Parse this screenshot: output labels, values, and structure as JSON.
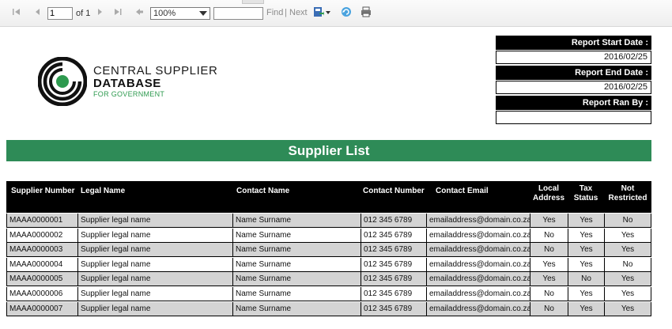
{
  "toolbar": {
    "page_current": "1",
    "page_of": "of 1",
    "zoom": "100%",
    "find_value": "",
    "find_label": "Find",
    "separator": "|",
    "next_label": "Next"
  },
  "logo": {
    "line1": "CENTRAL SUPPLIER",
    "line2": "DATABASE",
    "line3": "FOR GOVERNMENT"
  },
  "report_info": {
    "start_label": "Report Start Date :",
    "start_value": "2016/02/25",
    "end_label": "Report End Date  :",
    "end_value": "2016/02/25",
    "ran_by_label": "Report Ran By   :",
    "ran_by_value": ""
  },
  "title": "Supplier List",
  "table": {
    "headers": {
      "supplier_number": "Supplier Number",
      "legal_name": "Legal Name",
      "contact_name": "Contact Name",
      "contact_number": "Contact Number",
      "contact_email": "Contact Email",
      "local_address_1": "Local",
      "local_address_2": "Address",
      "tax_status_1": "Tax",
      "tax_status_2": "Status",
      "not_restricted_1": "Not",
      "not_restricted_2": "Restricted"
    },
    "rows": [
      {
        "num": "MAAA0000001",
        "legal": "Supplier legal name",
        "contact": "Name Surname",
        "phone": "012 345 6789",
        "email": "emailaddress@domain.co.za",
        "local": "Yes",
        "tax": "Yes",
        "restricted": "No"
      },
      {
        "num": "MAAA0000002",
        "legal": "Supplier legal name",
        "contact": "Name Surname",
        "phone": "012 345 6789",
        "email": "emailaddress@domain.co.za",
        "local": "No",
        "tax": "Yes",
        "restricted": "Yes"
      },
      {
        "num": "MAAA0000003",
        "legal": "Supplier legal name",
        "contact": "Name Surname",
        "phone": "012 345 6789",
        "email": "emailaddress@domain.co.za",
        "local": "No",
        "tax": "Yes",
        "restricted": "Yes"
      },
      {
        "num": "MAAA0000004",
        "legal": "Supplier legal name",
        "contact": "Name Surname",
        "phone": "012 345 6789",
        "email": "emailaddress@domain.co.za",
        "local": "Yes",
        "tax": "Yes",
        "restricted": "No"
      },
      {
        "num": "MAAA0000005",
        "legal": "Supplier legal name",
        "contact": "Name Surname",
        "phone": "012 345 6789",
        "email": "emailaddress@domain.co.za",
        "local": "Yes",
        "tax": "No",
        "restricted": "Yes"
      },
      {
        "num": "MAAA0000006",
        "legal": "Supplier legal name",
        "contact": "Name Surname",
        "phone": "012 345 6789",
        "email": "emailaddress@domain.co.za",
        "local": "No",
        "tax": "Yes",
        "restricted": "Yes"
      },
      {
        "num": "MAAA0000007",
        "legal": "Supplier legal name",
        "contact": "Name Surname",
        "phone": "012 345 6789",
        "email": "emailaddress@domain.co.za",
        "local": "No",
        "tax": "Yes",
        "restricted": "Yes"
      }
    ]
  },
  "colors": {
    "accent_green": "#2e8b57",
    "header_black": "#000000",
    "row_shade": "#d4d4d4"
  }
}
